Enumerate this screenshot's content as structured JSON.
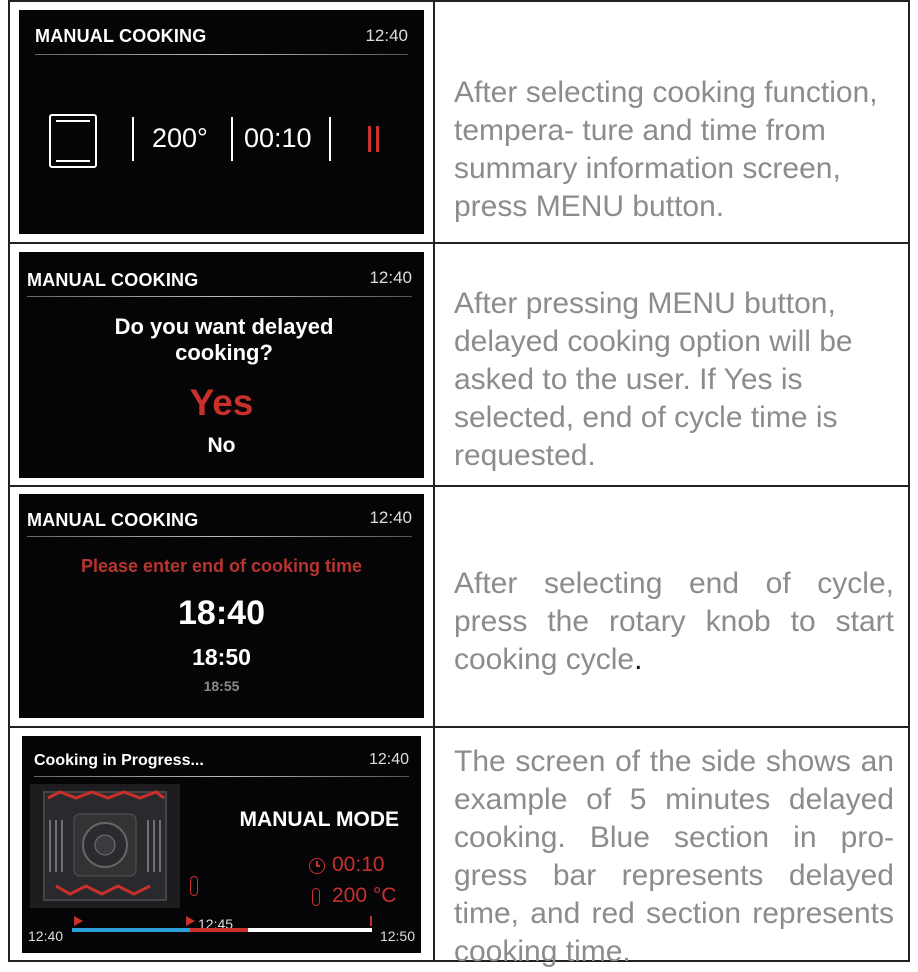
{
  "rows": [
    {
      "screen": {
        "title": "MANUAL COOKING",
        "time": "12:40",
        "temperature": "200°",
        "duration": "00:10",
        "pause_icon": "pause-icon",
        "function_icon": "oven-function-icon"
      },
      "description": "After selecting cooking function, tempera- ture and time from summary information screen, press MENU button."
    },
    {
      "screen": {
        "title": "MANUAL COOKING",
        "time": "12:40",
        "question": "Do you want delayed cooking?",
        "option_yes": "Yes",
        "option_no": "No"
      },
      "description": "After pressing MENU button, delayed cooking option will be asked to the user. If Yes is selected, end of cycle time is requested."
    },
    {
      "screen": {
        "title": "MANUAL COOKING",
        "time": "12:40",
        "prompt": "Please enter end of cooking time",
        "time_selected": "18:40",
        "time_next": "18:50",
        "time_next2": "18:55"
      },
      "description_main": "After selecting end of cycle, press the rotary knob to start cooking cycle",
      "description_end": "."
    },
    {
      "screen": {
        "title": "Cooking in Progress...",
        "time": "12:40",
        "mode": "MANUAL MODE",
        "duration": "00:10",
        "temperature": "200 °C",
        "progress": {
          "start": "12:40",
          "cook_start": "12:45",
          "end": "12:50"
        }
      },
      "description": "The screen of the side shows an example of 5 minutes delayed cooking. Blue section in pro- gress bar represents delayed time, and red section represents cooking time."
    }
  ],
  "colors": {
    "accent_red": "#c9302c",
    "delay_blue": "#2b9fd8",
    "screen_bg": "#050507",
    "desc_text": "#8c8c8c"
  }
}
